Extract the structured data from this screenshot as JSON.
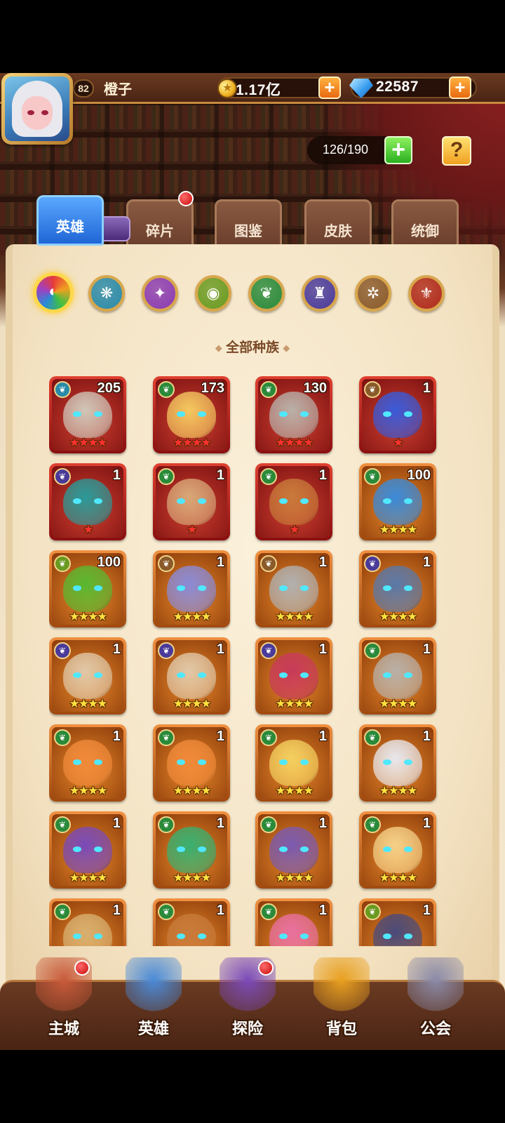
{
  "player": {
    "level": "82",
    "name": "橙子",
    "gold": "1.17亿",
    "gems": "22587"
  },
  "capacity": "126/190",
  "tabs": [
    {
      "label": "英雄",
      "active": true
    },
    {
      "label": "碎片",
      "active": false,
      "badge": true
    },
    {
      "label": "图鉴",
      "active": false
    },
    {
      "label": "皮肤",
      "active": false
    },
    {
      "label": "统御",
      "active": false
    }
  ],
  "factions": [
    {
      "name": "all-factions-icon",
      "color": "#e84a3a",
      "glyph": "◐",
      "selected": true
    },
    {
      "name": "faction-ice-icon",
      "color": "#2a8aa8",
      "glyph": "❋"
    },
    {
      "name": "faction-arcane-icon",
      "color": "#8a3ab0",
      "glyph": "✦"
    },
    {
      "name": "faction-eye-icon",
      "color": "#6a9a20",
      "glyph": "◉"
    },
    {
      "name": "faction-nature-icon",
      "color": "#2a8a3a",
      "glyph": "❦"
    },
    {
      "name": "faction-demon-icon",
      "color": "#4a3a9a",
      "glyph": "♜"
    },
    {
      "name": "faction-wheel-icon",
      "color": "#8a5a2a",
      "glyph": "✲"
    },
    {
      "name": "faction-fire-icon",
      "color": "#b02a1a",
      "glyph": "⚜"
    }
  ],
  "race_filter": "全部种族",
  "heroes": [
    {
      "level": "205",
      "stars": "★★★★",
      "star_color": "red",
      "frame": "red",
      "faction": "#2a8aa8",
      "skin": "#cfc6b8"
    },
    {
      "level": "173",
      "stars": "★★★★",
      "star_color": "red",
      "frame": "red",
      "faction": "#2a8a3a",
      "skin": "#f4c860"
    },
    {
      "level": "130",
      "stars": "★★★★",
      "star_color": "red",
      "frame": "red",
      "faction": "#2a8a3a",
      "skin": "#b8b0a8"
    },
    {
      "level": "1",
      "stars": "★",
      "star_color": "red",
      "frame": "red",
      "faction": "#8a5a2a",
      "skin": "#3a5ad8"
    },
    {
      "level": "1",
      "stars": "★",
      "star_color": "red",
      "frame": "red",
      "faction": "#4a3a9a",
      "skin": "#2a9a98"
    },
    {
      "level": "1",
      "stars": "★",
      "star_color": "red",
      "frame": "red",
      "faction": "#2a8a3a",
      "skin": "#d8a878"
    },
    {
      "level": "1",
      "stars": "★",
      "star_color": "red",
      "frame": "red",
      "faction": "#2a8a3a",
      "skin": "#c87a3a"
    },
    {
      "level": "100",
      "stars": "★★★★",
      "star_color": "gold",
      "frame": "orange",
      "faction": "#2a8a3a",
      "skin": "#3a8ad8"
    },
    {
      "level": "100",
      "stars": "★★★★",
      "star_color": "gold",
      "frame": "orange",
      "faction": "#6a9a20",
      "skin": "#5ab830"
    },
    {
      "level": "1",
      "stars": "★★★★",
      "star_color": "gold",
      "frame": "orange",
      "faction": "#8a5a2a",
      "skin": "#8a8ad8"
    },
    {
      "level": "1",
      "stars": "★★★★",
      "star_color": "gold",
      "frame": "orange",
      "faction": "#8a5a2a",
      "skin": "#b0b0b0"
    },
    {
      "level": "1",
      "stars": "★★★★",
      "star_color": "gold",
      "frame": "orange",
      "faction": "#4a3a9a",
      "skin": "#5a78a8"
    },
    {
      "level": "1",
      "stars": "★★★★",
      "star_color": "gold",
      "frame": "orange",
      "faction": "#4a3a9a",
      "skin": "#e0c8a8"
    },
    {
      "level": "1",
      "stars": "★★★★",
      "star_color": "gold",
      "frame": "orange",
      "faction": "#4a3a9a",
      "skin": "#e0c8a8"
    },
    {
      "level": "1",
      "stars": "★★★★",
      "star_color": "gold",
      "frame": "orange",
      "faction": "#4a3a9a",
      "skin": "#c83a5a"
    },
    {
      "level": "1",
      "stars": "★★★★",
      "star_color": "gold",
      "frame": "orange",
      "faction": "#2a8a3a",
      "skin": "#b8b0a8"
    },
    {
      "level": "1",
      "stars": "★★★★",
      "star_color": "gold",
      "frame": "orange",
      "faction": "#2a8a3a",
      "skin": "#f08a3a"
    },
    {
      "level": "1",
      "stars": "★★★★",
      "star_color": "gold",
      "frame": "orange",
      "faction": "#2a8a3a",
      "skin": "#f08a3a"
    },
    {
      "level": "1",
      "stars": "★★★★",
      "star_color": "gold",
      "frame": "orange",
      "faction": "#2a8a3a",
      "skin": "#f4d060"
    },
    {
      "level": "1",
      "stars": "★★★★",
      "star_color": "gold",
      "frame": "orange",
      "faction": "#2a8a3a",
      "skin": "#e8e8ee"
    },
    {
      "level": "1",
      "stars": "★★★★",
      "star_color": "gold",
      "frame": "orange",
      "faction": "#2a8a3a",
      "skin": "#7a4ab8"
    },
    {
      "level": "1",
      "stars": "★★★★",
      "star_color": "gold",
      "frame": "orange",
      "faction": "#2a8a3a",
      "skin": "#38b070"
    },
    {
      "level": "1",
      "stars": "★★★★",
      "star_color": "gold",
      "frame": "orange",
      "faction": "#2a8a3a",
      "skin": "#7a5ab0"
    },
    {
      "level": "1",
      "stars": "★★★★",
      "star_color": "gold",
      "frame": "orange",
      "faction": "#2a8a3a",
      "skin": "#f4d088"
    },
    {
      "level": "1",
      "stars": "",
      "star_color": "gold",
      "frame": "orange",
      "faction": "#2a8a3a",
      "skin": "#d8b070"
    },
    {
      "level": "1",
      "stars": "",
      "star_color": "gold",
      "frame": "orange",
      "faction": "#2a8a3a",
      "skin": "#c87a3a"
    },
    {
      "level": "1",
      "stars": "",
      "star_color": "gold",
      "frame": "orange",
      "faction": "#2a8a3a",
      "skin": "#e870a0"
    },
    {
      "level": "1",
      "stars": "",
      "star_color": "gold",
      "frame": "orange",
      "faction": "#6a9a20",
      "skin": "#4a4a7a"
    }
  ],
  "nav": [
    {
      "label": "主城",
      "icon": "castle-icon",
      "badge": true,
      "color": "#c85a3a"
    },
    {
      "label": "英雄",
      "icon": "hero-icon",
      "badge": false,
      "color": "#4a8ad8"
    },
    {
      "label": "探险",
      "icon": "portal-icon",
      "badge": true,
      "color": "#7a4ab8"
    },
    {
      "label": "背包",
      "icon": "backpack-icon",
      "badge": false,
      "color": "#e8a020"
    },
    {
      "label": "公会",
      "icon": "guild-icon",
      "badge": false,
      "color": "#8a8aa8"
    }
  ]
}
